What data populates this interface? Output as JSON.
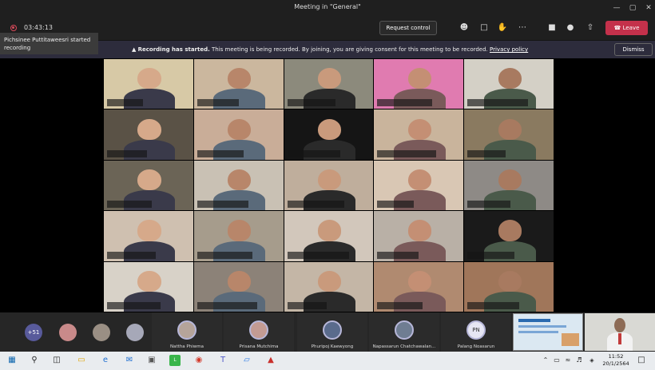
{
  "window": {
    "title": "Meeting in \"General\"",
    "minimize": "—",
    "maximize": "▢",
    "close": "✕"
  },
  "meeting": {
    "timer": "03:43:13",
    "request_control": "Request control",
    "leave": "Leave",
    "icons": [
      "people-icon",
      "chat-icon",
      "raise-hand-icon",
      "more-icon",
      "camera-icon",
      "mic-icon",
      "share-icon"
    ]
  },
  "toast": {
    "text": "Pichsinee Puttitaweesri started recording"
  },
  "banner": {
    "strong": "Recording has started.",
    "text": " This meeting is being recorded. By joining, you are giving consent for this meeting to be recorded. ",
    "link": "Privacy policy",
    "dismiss": "Dismiss"
  },
  "strip": {
    "overflow_count": "+51",
    "participants": [
      {
        "name": "Nattha Phiwma"
      },
      {
        "name": "Prisana Mutchima"
      },
      {
        "name": "Phuripoj Kaewyong"
      },
      {
        "name": "Napassarun Chatchawalan..."
      },
      {
        "name": "Palang Noasarun",
        "initials": "PN"
      }
    ]
  },
  "taskbar": {
    "time": "11:52",
    "date": "20/1/2564"
  },
  "colors": {
    "leave": "#c4314b",
    "banner": "#2d2c3c",
    "accent": "#585a9b"
  }
}
